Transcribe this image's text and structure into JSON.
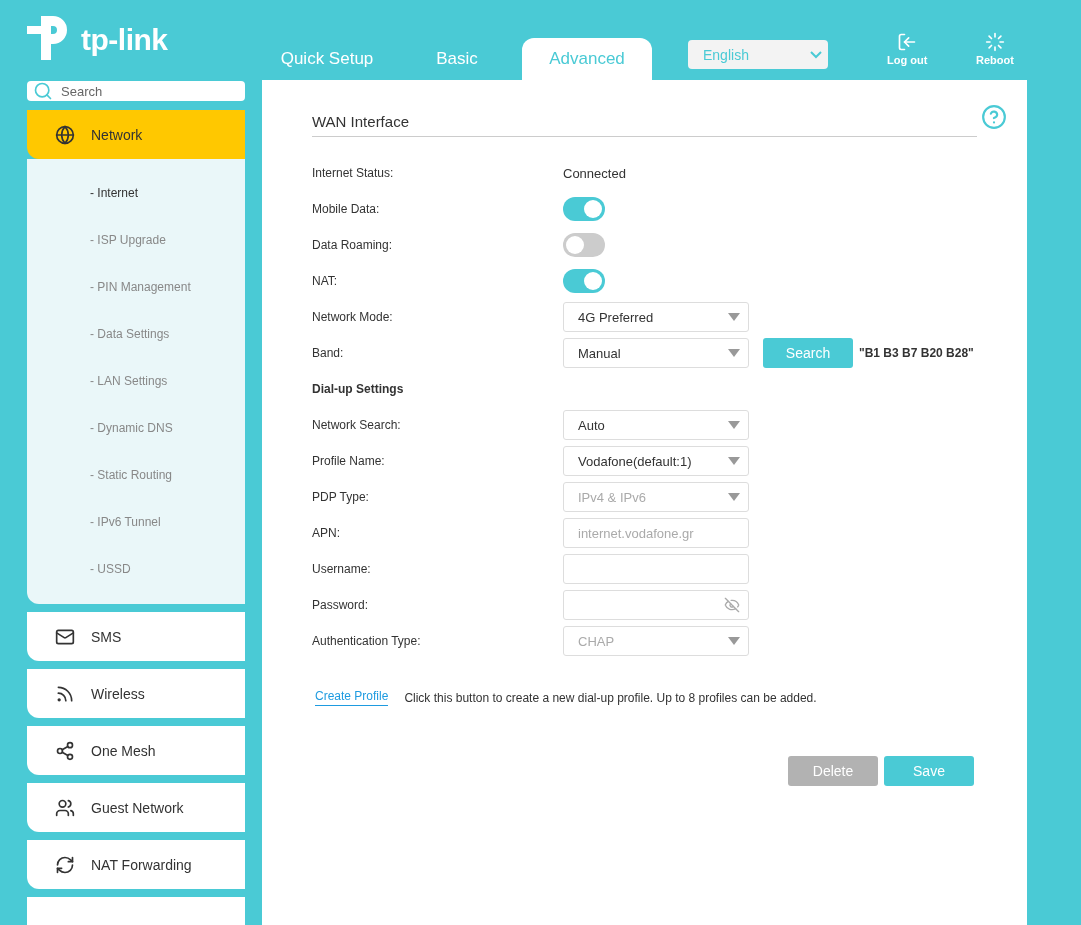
{
  "logo": {
    "text": "tp-link"
  },
  "tabs": [
    {
      "label": "Quick Setup",
      "selected": false
    },
    {
      "label": "Basic",
      "selected": false
    },
    {
      "label": "Advanced",
      "selected": true
    }
  ],
  "language": {
    "value": "English"
  },
  "header_actions": [
    {
      "label": "Log out",
      "kind": "logout"
    },
    {
      "label": "Reboot",
      "kind": "reboot"
    }
  ],
  "sidebar": {
    "search": {
      "placeholder": "Search"
    },
    "items": [
      {
        "label": "Network",
        "selected": true,
        "expanded": true,
        "children": [
          {
            "label": "- Internet",
            "selected": true
          },
          {
            "label": "- ISP Upgrade",
            "selected": false
          },
          {
            "label": "- PIN Management",
            "selected": false
          },
          {
            "label": "- Data Settings",
            "selected": false
          },
          {
            "label": "- LAN Settings",
            "selected": false
          },
          {
            "label": "- Dynamic DNS",
            "selected": false
          },
          {
            "label": "- Static Routing",
            "selected": false
          },
          {
            "label": "- IPv6 Tunnel",
            "selected": false
          },
          {
            "label": "- USSD",
            "selected": false
          }
        ]
      },
      {
        "label": "SMS",
        "selected": false
      },
      {
        "label": "Wireless",
        "selected": false
      },
      {
        "label": "One Mesh",
        "selected": false
      },
      {
        "label": "Guest Network",
        "selected": false
      },
      {
        "label": "NAT Forwarding",
        "selected": false
      }
    ]
  },
  "panel": {
    "title": "WAN Interface",
    "fields": [
      {
        "kind": "text",
        "label": "Internet Status:",
        "value": "Connected"
      },
      {
        "kind": "toggle",
        "label": "Mobile Data:",
        "on": true
      },
      {
        "kind": "toggle",
        "label": "Data Roaming:",
        "on": false
      },
      {
        "kind": "toggle",
        "label": "NAT:",
        "on": true
      },
      {
        "kind": "select",
        "label": "Network Mode:",
        "value": "4G Preferred",
        "disabled": false
      },
      {
        "kind": "select",
        "label": "Band:",
        "value": "Manual",
        "disabled": false,
        "button": "Search",
        "note": "\"B1 B3 B7 B20 B28\""
      },
      {
        "kind": "heading",
        "label": "Dial-up Settings"
      },
      {
        "kind": "select",
        "label": "Network Search:",
        "value": "Auto",
        "disabled": false
      },
      {
        "kind": "select",
        "label": "Profile Name:",
        "value": "Vodafone(default:1)",
        "disabled": false
      },
      {
        "kind": "select",
        "label": "PDP Type:",
        "value": "IPv4 & IPv6",
        "disabled": true
      },
      {
        "kind": "input",
        "label": "APN:",
        "value": "internet.vodafone.gr",
        "disabled": true
      },
      {
        "kind": "input",
        "label": "Username:"
      },
      {
        "kind": "password",
        "label": "Password:"
      },
      {
        "kind": "select",
        "label": "Authentication Type:",
        "value": "CHAP",
        "disabled": true
      }
    ],
    "create_link": "Create Profile",
    "create_hint": "Click this button to create a new dial-up profile. Up to 8 profiles can be added.",
    "buttons": [
      {
        "label": "Delete",
        "kind": "secondary"
      },
      {
        "label": "Save",
        "kind": "primary"
      }
    ]
  }
}
